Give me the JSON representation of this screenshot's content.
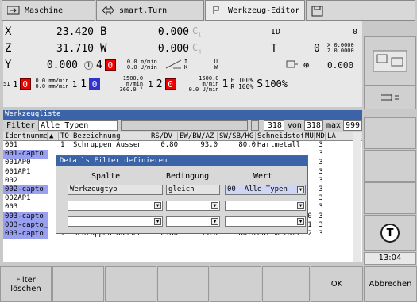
{
  "tabs": [
    {
      "label": "Maschine"
    },
    {
      "label": "smart.Turn"
    },
    {
      "label": "Werkzeug-Editor"
    },
    {
      "label": ""
    }
  ],
  "axes": {
    "x": {
      "label": "X",
      "value": "23.420"
    },
    "z": {
      "label": "Z",
      "value": "31.710"
    },
    "y": {
      "label": "Y",
      "value": "0.000"
    },
    "b": {
      "label": "B",
      "value": "0.000"
    },
    "w": {
      "label": "W",
      "value": "0.000"
    },
    "c1": "C",
    "c1sub": "1",
    "c4": "C",
    "c4sub": "4",
    "four": "4",
    "one": "1"
  },
  "right_info": {
    "id_label": "ID",
    "id_value": "0",
    "t_label": "T",
    "t_value": "0",
    "x_sub": "X",
    "x_sub_val": "0.0000",
    "z_sub": "Z",
    "z_sub_val": "0.0000",
    "val3": "0.000",
    "i": "I",
    "k": "K",
    "u": "U",
    "w": "W"
  },
  "feed": {
    "mmin1": "0.0 m/min",
    "umin1": "0.0 U/min",
    "mmin2": "0.0 mm/min",
    "umin2": "0.0 mm/min",
    "spindle1": "1500.0 m/min",
    "spindle1b": "360.0 °",
    "spindle2": "1500.0 m/min",
    "spindle2b": "0.0 U/min",
    "s1": "1",
    "s2": "1",
    "s3": "1",
    "s4": "2",
    "s5": "1",
    "f_label": "F 100%",
    "r_label": "R 100%",
    "s_label": "S",
    "s_pct": "100%",
    "zero": "0",
    "red1": "0",
    "red2": "0",
    "blue1": "0",
    "sp51": "51"
  },
  "list": {
    "title": "Werkzeugliste",
    "filter_label": "Filter",
    "filter_value": "Alle Typen",
    "count": "318",
    "von": "von",
    "total": "318",
    "max_label": "max",
    "max_value": "999",
    "headers": [
      "Identnummer",
      "▲",
      "TO",
      "Bezeichnung",
      "RS/DV",
      "EW/BW/AZ",
      "SW/SB/HG",
      "Schneidstoff",
      "MU",
      "MD",
      "LA"
    ],
    "rows": [
      {
        "id": "001",
        "to": "1",
        "name": "Schruppen Aussen",
        "rs": "0.80",
        "ew": "93.0",
        "sw": "80.0",
        "mat": "Hartmetall",
        "mu": "",
        "md": "3",
        "sel": false
      },
      {
        "id": "001-capto",
        "to": "",
        "name": "",
        "rs": "",
        "ew": "",
        "sw": "",
        "mat": "",
        "mu": "",
        "md": "3",
        "sel": true
      },
      {
        "id": "001AP0",
        "to": "",
        "name": "",
        "rs": "",
        "ew": "",
        "sw": "",
        "mat": "",
        "mu": "",
        "md": "3",
        "sel": false
      },
      {
        "id": "001AP1",
        "to": "",
        "name": "",
        "rs": "",
        "ew": "",
        "sw": "",
        "mat": "",
        "mu": "",
        "md": "3",
        "sel": false
      },
      {
        "id": "002",
        "to": "",
        "name": "",
        "rs": "",
        "ew": "",
        "sw": "",
        "mat": "",
        "mu": "",
        "md": "3",
        "sel": false
      },
      {
        "id": "002-capto",
        "to": "",
        "name": "",
        "rs": "",
        "ew": "",
        "sw": "",
        "mat": "",
        "mu": "",
        "md": "3",
        "sel": true
      },
      {
        "id": "002AP1",
        "to": "",
        "name": "",
        "rs": "",
        "ew": "",
        "sw": "",
        "mat": "",
        "mu": "",
        "md": "3",
        "sel": false
      },
      {
        "id": "003",
        "to": "",
        "name": "",
        "rs": "",
        "ew": "",
        "sw": "",
        "mat": "",
        "mu": "",
        "md": "3",
        "sel": false
      },
      {
        "id": "003-capto",
        "to": "1",
        "name": "Schruppen Aussen",
        "rs": "0.80",
        "ew": "93.0",
        "sw": "80.0",
        "mat": "Hartmetall",
        "mu": "0",
        "md": "3",
        "sel": true
      },
      {
        "id": "003-capto_1",
        "to": "1",
        "name": "Schruppen Aussen",
        "rs": "0.80",
        "ew": "93.0",
        "sw": "80.0",
        "mat": "Hartmetall",
        "mu": "1",
        "md": "3",
        "sel": true
      },
      {
        "id": "003-capto 2",
        "to": "1",
        "name": "Schruppen Aussen",
        "rs": "0.80",
        "ew": "93.0",
        "sw": "80.0",
        "mat": "Hartmetall",
        "mu": "2",
        "md": "3",
        "sel": true
      }
    ]
  },
  "dialog": {
    "title": "Details Filter definieren",
    "col_spalte": "Spalte",
    "col_bedingung": "Bedingung",
    "col_wert": "Wert",
    "row1_spalte": "Werkzeugtyp",
    "row1_bed": "gleich",
    "row1_wert_code": "00",
    "row1_wert": "Alle Typen"
  },
  "clock": "13:04",
  "softkeys": {
    "filter_loeschen": "Filter\nlöschen",
    "ok": "OK",
    "abbrechen": "Abbrechen",
    "t_icon": "T"
  }
}
